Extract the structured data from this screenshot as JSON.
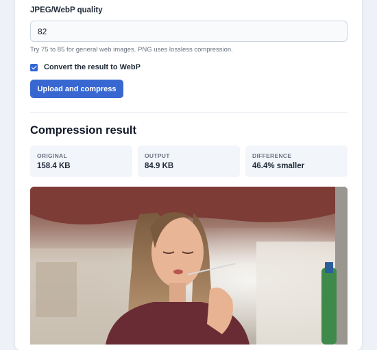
{
  "form": {
    "quality_label": "JPEG/WebP quality",
    "quality_value": "82",
    "hint": "Try 75 to 85 for general web images. PNG uses lossless compression.",
    "convert_checked": true,
    "convert_label": "Convert the result to WebP",
    "submit_label": "Upload and compress"
  },
  "result": {
    "title": "Compression result",
    "stats": [
      {
        "label": "ORIGINAL",
        "value": "158.4 KB"
      },
      {
        "label": "OUTPUT",
        "value": "84.9 KB"
      },
      {
        "label": "DIFFERENCE",
        "value": "46.4% smaller"
      }
    ]
  },
  "colors": {
    "accent": "#3867d1",
    "page_bg": "#eef1f7",
    "stat_bg": "#f2f5fa"
  }
}
